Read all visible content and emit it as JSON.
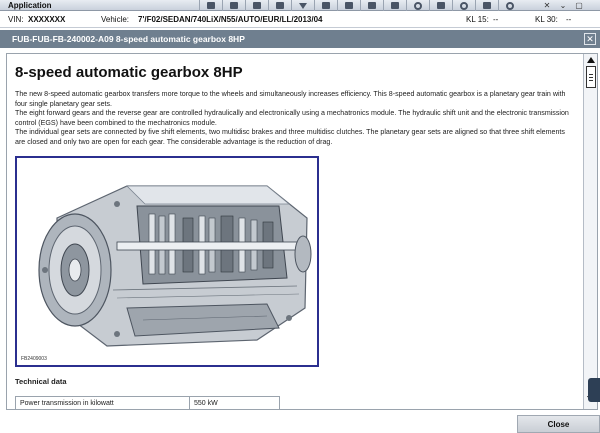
{
  "app": {
    "title": "Application",
    "window_controls": [
      "✕",
      "⌄",
      "▢"
    ]
  },
  "vehicle_bar": {
    "vin_label": "VIN:",
    "vin_value": "XXXXXXX",
    "vehicle_label": "Vehicle:",
    "vehicle_value": "7'/F02/SEDAN/740LiX/N55/AUTO/EUR/LL/2013/04",
    "kl15_label": "KL 15:",
    "kl15_value": "--",
    "kl30_label": "KL 30:",
    "kl30_value": "--"
  },
  "window": {
    "title": "FUB-FUB-FB-240002-A09 8-speed automatic gearbox 8HP",
    "close_glyph": "✕"
  },
  "document": {
    "heading": "8-speed automatic gearbox 8HP",
    "paragraphs": [
      "The new 8-speed automatic gearbox transfers more torque to the wheels and simultaneously increases efficiency. This 8-speed automatic gearbox is a planetary gear train with four single planetary gear sets.",
      "The eight forward gears and the reverse gear are controlled hydraulically and electronically using a mechatronics module. The hydraulic shift unit and the electronic transmission control (EGS) have been combined to the mechatronics module.",
      "The individual gear sets are connected by five shift elements, two multidisc brakes and three multidisc clutches. The planetary gear sets are aligned so that three shift elements are closed and only two are open for each gear. The considerable advantage is the reduction of drag."
    ],
    "figure_caption": "FB2409003",
    "section_title": "Technical data",
    "tech_table": [
      {
        "label": "Power transmission in kilowatt",
        "value": "550 kW"
      }
    ]
  },
  "footer": {
    "close_label": "Close"
  }
}
